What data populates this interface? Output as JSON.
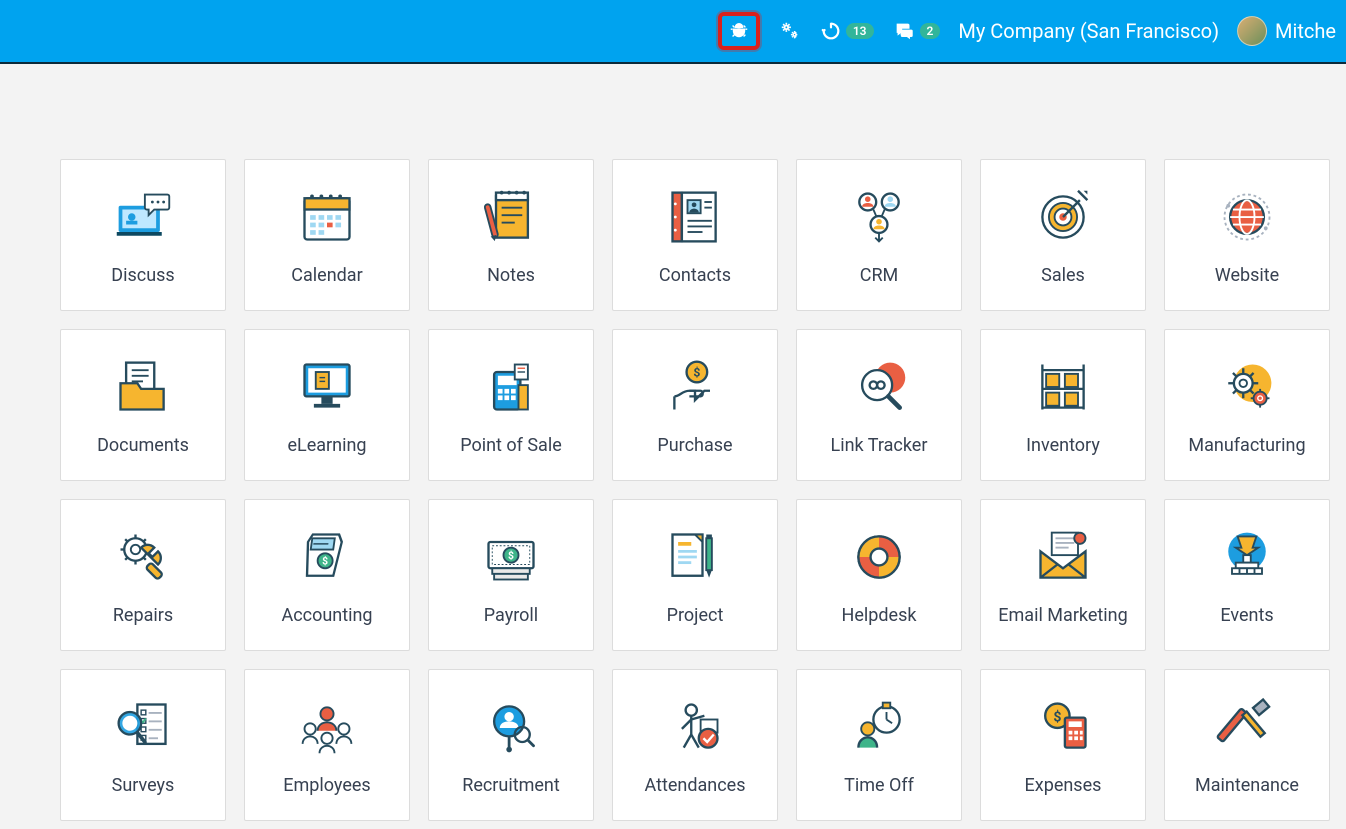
{
  "header": {
    "debug_highlighted": true,
    "clock_badge": "13",
    "chat_badge": "2",
    "company": "My Company (San Francisco)",
    "username": "Mitche"
  },
  "apps": [
    {
      "id": "discuss",
      "label": "Discuss"
    },
    {
      "id": "calendar",
      "label": "Calendar"
    },
    {
      "id": "notes",
      "label": "Notes"
    },
    {
      "id": "contacts",
      "label": "Contacts"
    },
    {
      "id": "crm",
      "label": "CRM"
    },
    {
      "id": "sales",
      "label": "Sales"
    },
    {
      "id": "website",
      "label": "Website"
    },
    {
      "id": "documents",
      "label": "Documents"
    },
    {
      "id": "elearning",
      "label": "eLearning"
    },
    {
      "id": "pos",
      "label": "Point of Sale"
    },
    {
      "id": "purchase",
      "label": "Purchase"
    },
    {
      "id": "linktracker",
      "label": "Link Tracker"
    },
    {
      "id": "inventory",
      "label": "Inventory"
    },
    {
      "id": "manufacturing",
      "label": "Manufacturing"
    },
    {
      "id": "repairs",
      "label": "Repairs"
    },
    {
      "id": "accounting",
      "label": "Accounting"
    },
    {
      "id": "payroll",
      "label": "Payroll"
    },
    {
      "id": "project",
      "label": "Project"
    },
    {
      "id": "helpdesk",
      "label": "Helpdesk"
    },
    {
      "id": "emailmarketing",
      "label": "Email Marketing"
    },
    {
      "id": "events",
      "label": "Events"
    },
    {
      "id": "surveys",
      "label": "Surveys"
    },
    {
      "id": "employees",
      "label": "Employees"
    },
    {
      "id": "recruitment",
      "label": "Recruitment"
    },
    {
      "id": "attendances",
      "label": "Attendances"
    },
    {
      "id": "timeoff",
      "label": "Time Off"
    },
    {
      "id": "expenses",
      "label": "Expenses"
    },
    {
      "id": "maintenance",
      "label": "Maintenance"
    }
  ]
}
